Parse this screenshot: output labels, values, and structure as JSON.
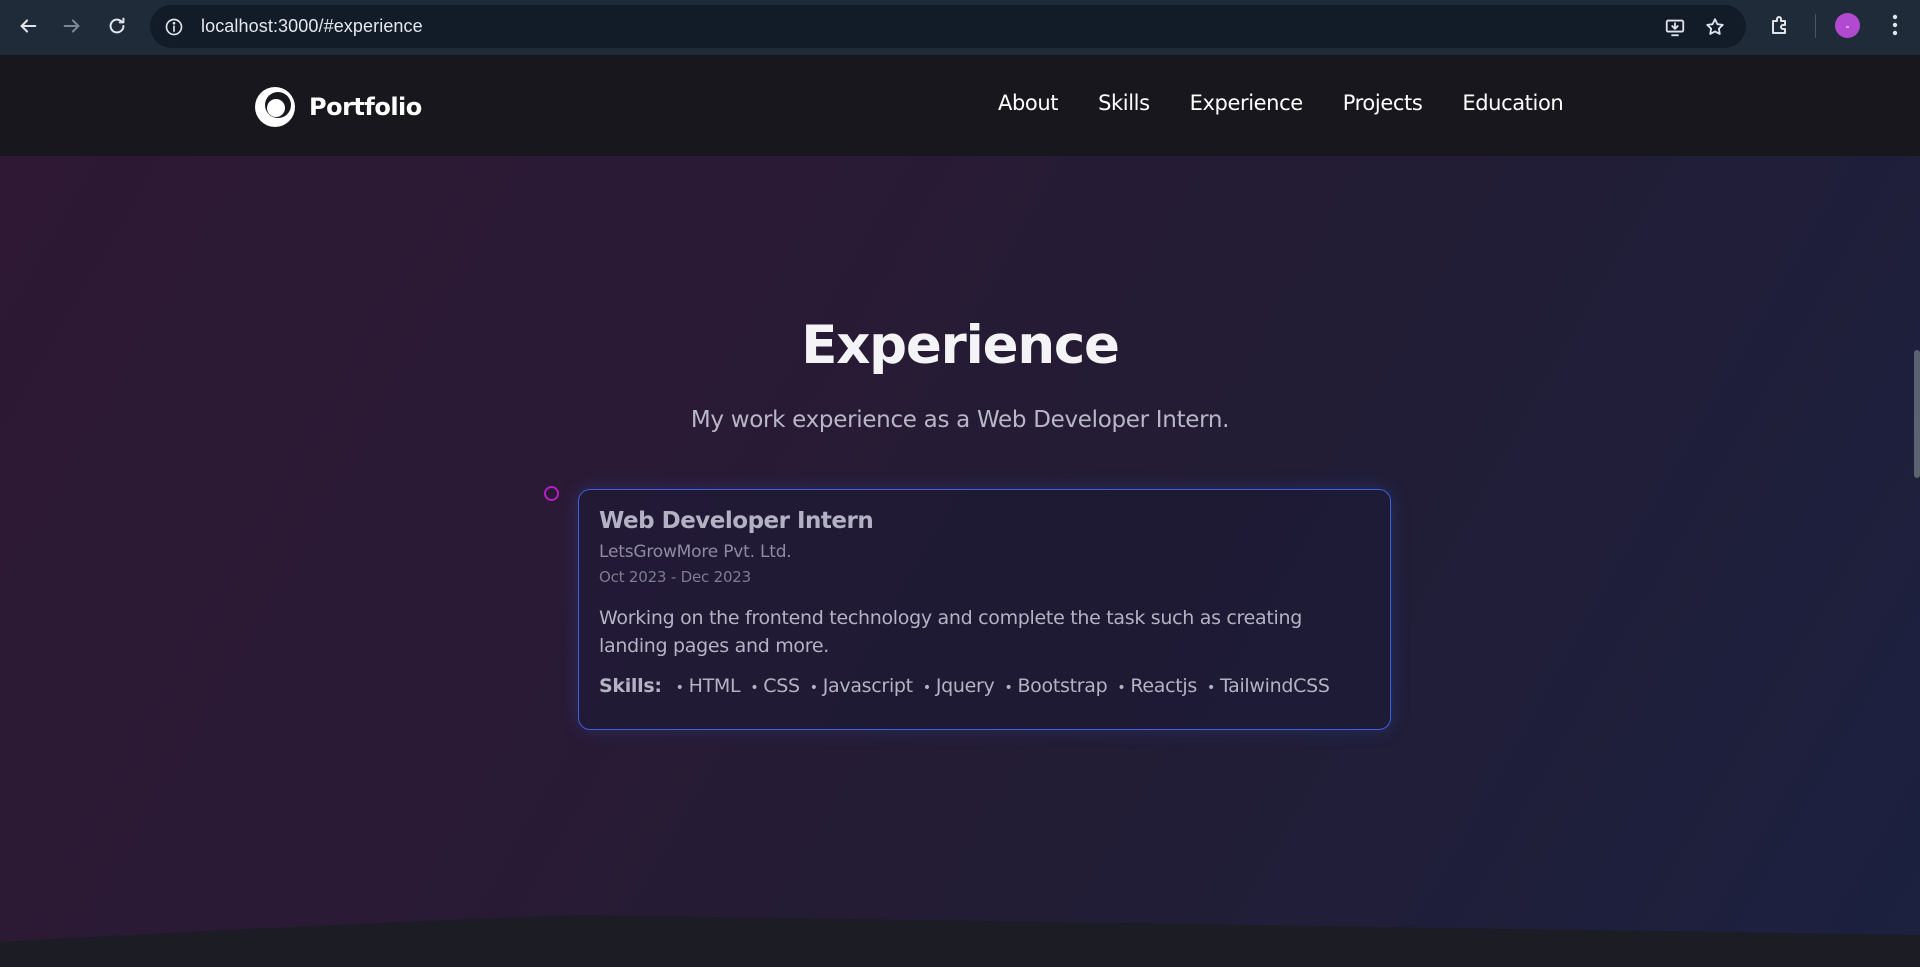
{
  "browser": {
    "url": "localhost:3000/#experience",
    "icons": {
      "back": "back-arrow-icon",
      "forward": "forward-arrow-icon",
      "reload": "reload-icon",
      "site_info": "info-icon",
      "install": "install-app-icon",
      "bookmark": "star-icon",
      "extensions": "puzzle-icon",
      "menu": "kebab-menu-icon"
    },
    "profile_initial": "-"
  },
  "header": {
    "logo_text": "Portfolio",
    "nav": [
      {
        "label": "About"
      },
      {
        "label": "Skills"
      },
      {
        "label": "Experience"
      },
      {
        "label": "Projects"
      },
      {
        "label": "Education"
      }
    ]
  },
  "experience": {
    "title": "Experience",
    "subtitle": "My work experience as a Web Developer Intern.",
    "items": [
      {
        "role": "Web Developer Intern",
        "company": "LetsGrowMore Pvt. Ltd.",
        "date": "Oct 2023 - Dec 2023",
        "description": "Working on the frontend technology and complete the task such as creating landing pages and more.",
        "skills_label": "Skills:",
        "skills": [
          "HTML",
          "CSS",
          "Javascript",
          "Jquery",
          "Bootstrap",
          "Reactjs",
          "TailwindCSS"
        ]
      }
    ]
  },
  "colors": {
    "accent_border": "#3d5fe0",
    "timeline_dot": "#b51fc4",
    "profile_avatar": "#b24ad1"
  }
}
